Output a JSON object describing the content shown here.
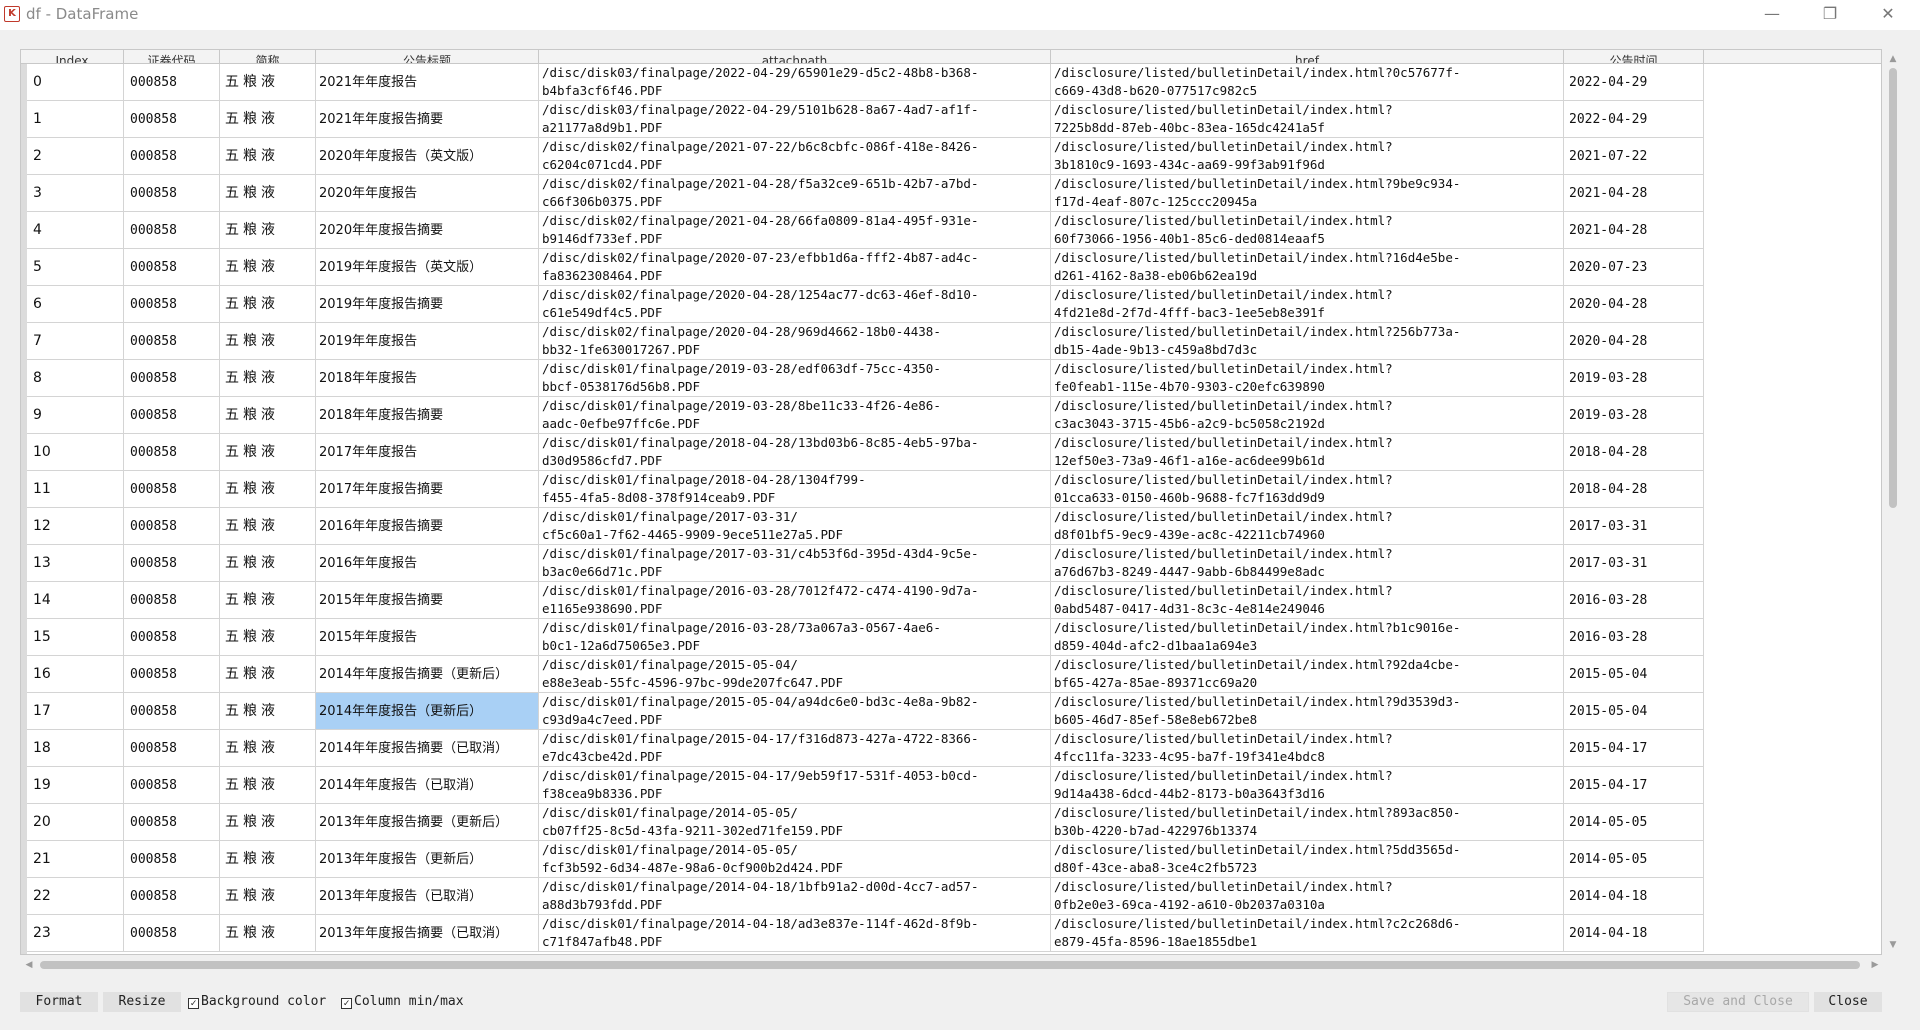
{
  "window": {
    "title": "df - DataFrame",
    "icon_glyph": "K",
    "minimize_glyph": "—",
    "restore_glyph": "❐",
    "close_glyph": "✕"
  },
  "columns": [
    "Index",
    "证券代码",
    "简称",
    "公告标题",
    "attachpath",
    "href",
    "公告时间"
  ],
  "rows": [
    {
      "index": "0",
      "code": "000858",
      "name": "五粮液",
      "title": "2021年年度报告",
      "attach": "/disc/disk03/finalpage/2022-04-29/65901e29-d5c2-48b8-b368-\nb4bfa3cf6f46.PDF",
      "href": "/disclosure/listed/bulletinDetail/index.html?0c57677f-\nc669-43d8-b620-077517c982c5",
      "date": "2022-04-29"
    },
    {
      "index": "1",
      "code": "000858",
      "name": "五粮液",
      "title": "2021年年度报告摘要",
      "attach": "/disc/disk03/finalpage/2022-04-29/5101b628-8a67-4ad7-af1f-\na21177a8d9b1.PDF",
      "href": "/disclosure/listed/bulletinDetail/index.html?\n7225b8dd-87eb-40bc-83ea-165dc4241a5f",
      "date": "2022-04-29"
    },
    {
      "index": "2",
      "code": "000858",
      "name": "五粮液",
      "title": "2020年年度报告（英文版）",
      "attach": "/disc/disk02/finalpage/2021-07-22/b6c8cbfc-086f-418e-8426-\nc6204c071cd4.PDF",
      "href": "/disclosure/listed/bulletinDetail/index.html?\n3b1810c9-1693-434c-aa69-99f3ab91f96d",
      "date": "2021-07-22"
    },
    {
      "index": "3",
      "code": "000858",
      "name": "五粮液",
      "title": "2020年年度报告",
      "attach": "/disc/disk02/finalpage/2021-04-28/f5a32ce9-651b-42b7-a7bd-\nc66f306b0375.PDF",
      "href": "/disclosure/listed/bulletinDetail/index.html?9be9c934-\nf17d-4eaf-807c-125ccc20945a",
      "date": "2021-04-28"
    },
    {
      "index": "4",
      "code": "000858",
      "name": "五粮液",
      "title": "2020年年度报告摘要",
      "attach": "/disc/disk02/finalpage/2021-04-28/66fa0809-81a4-495f-931e-\nb9146df733ef.PDF",
      "href": "/disclosure/listed/bulletinDetail/index.html?\n60f73066-1956-40b1-85c6-ded0814eaaf5",
      "date": "2021-04-28"
    },
    {
      "index": "5",
      "code": "000858",
      "name": "五粮液",
      "title": "2019年年度报告（英文版）",
      "attach": "/disc/disk02/finalpage/2020-07-23/efbb1d6a-fff2-4b87-ad4c-\nfa8362308464.PDF",
      "href": "/disclosure/listed/bulletinDetail/index.html?16d4e5be-\nd261-4162-8a38-eb06b62ea19d",
      "date": "2020-07-23"
    },
    {
      "index": "6",
      "code": "000858",
      "name": "五粮液",
      "title": "2019年年度报告摘要",
      "attach": "/disc/disk02/finalpage/2020-04-28/1254ac77-dc63-46ef-8d10-\nc61e549df4c5.PDF",
      "href": "/disclosure/listed/bulletinDetail/index.html?\n4fd21e8d-2f7d-4fff-bac3-1ee5eb8e391f",
      "date": "2020-04-28"
    },
    {
      "index": "7",
      "code": "000858",
      "name": "五粮液",
      "title": "2019年年度报告",
      "attach": "/disc/disk02/finalpage/2020-04-28/969d4662-18b0-4438-\nbb32-1fe630017267.PDF",
      "href": "/disclosure/listed/bulletinDetail/index.html?256b773a-\ndb15-4ade-9b13-c459a8bd7d3c",
      "date": "2020-04-28"
    },
    {
      "index": "8",
      "code": "000858",
      "name": "五粮液",
      "title": "2018年年度报告",
      "attach": "/disc/disk01/finalpage/2019-03-28/edf063df-75cc-4350-\nbbcf-0538176d56b8.PDF",
      "href": "/disclosure/listed/bulletinDetail/index.html?\nfe0feab1-115e-4b70-9303-c20efc639890",
      "date": "2019-03-28"
    },
    {
      "index": "9",
      "code": "000858",
      "name": "五粮液",
      "title": "2018年年度报告摘要",
      "attach": "/disc/disk01/finalpage/2019-03-28/8be11c33-4f26-4e86-\naadc-0efbe97ffc6e.PDF",
      "href": "/disclosure/listed/bulletinDetail/index.html?\nc3ac3043-3715-45b6-a2c9-bc5058c2192d",
      "date": "2019-03-28"
    },
    {
      "index": "10",
      "code": "000858",
      "name": "五粮液",
      "title": "2017年年度报告",
      "attach": "/disc/disk01/finalpage/2018-04-28/13bd03b6-8c85-4eb5-97ba-\nd30d9586cfd7.PDF",
      "href": "/disclosure/listed/bulletinDetail/index.html?\n12ef50e3-73a9-46f1-a16e-ac6dee99b61d",
      "date": "2018-04-28"
    },
    {
      "index": "11",
      "code": "000858",
      "name": "五粮液",
      "title": "2017年年度报告摘要",
      "attach": "/disc/disk01/finalpage/2018-04-28/1304f799-\nf455-4fa5-8d08-378f914ceab9.PDF",
      "href": "/disclosure/listed/bulletinDetail/index.html?\n01cca633-0150-460b-9688-fc7f163dd9d9",
      "date": "2018-04-28"
    },
    {
      "index": "12",
      "code": "000858",
      "name": "五粮液",
      "title": "2016年年度报告摘要",
      "attach": "/disc/disk01/finalpage/2017-03-31/\ncf5c60a1-7f62-4465-9909-9ece511e27a5.PDF",
      "href": "/disclosure/listed/bulletinDetail/index.html?\nd8f01bf5-9ec9-439e-ac8c-42211cb74960",
      "date": "2017-03-31"
    },
    {
      "index": "13",
      "code": "000858",
      "name": "五粮液",
      "title": "2016年年度报告",
      "attach": "/disc/disk01/finalpage/2017-03-31/c4b53f6d-395d-43d4-9c5e-\nb3ac0e66d71c.PDF",
      "href": "/disclosure/listed/bulletinDetail/index.html?\na76d67b3-8249-4447-9abb-6b84499e8adc",
      "date": "2017-03-31"
    },
    {
      "index": "14",
      "code": "000858",
      "name": "五粮液",
      "title": "2015年年度报告摘要",
      "attach": "/disc/disk01/finalpage/2016-03-28/7012f472-c474-4190-9d7a-\ne1165e938690.PDF",
      "href": "/disclosure/listed/bulletinDetail/index.html?\n0abd5487-0417-4d31-8c3c-4e814e249046",
      "date": "2016-03-28"
    },
    {
      "index": "15",
      "code": "000858",
      "name": "五粮液",
      "title": "2015年年度报告",
      "attach": "/disc/disk01/finalpage/2016-03-28/73a067a3-0567-4ae6-\nb0c1-12a6d75065e3.PDF",
      "href": "/disclosure/listed/bulletinDetail/index.html?b1c9016e-\nd859-404d-afc2-d1baa1a694e3",
      "date": "2016-03-28"
    },
    {
      "index": "16",
      "code": "000858",
      "name": "五粮液",
      "title": "2014年年度报告摘要（更新后）",
      "attach": "/disc/disk01/finalpage/2015-05-04/\ne88e3eab-55fc-4596-97bc-99de207fc647.PDF",
      "href": "/disclosure/listed/bulletinDetail/index.html?92da4cbe-\nbf65-427a-85ae-89371cc69a20",
      "date": "2015-05-04"
    },
    {
      "index": "17",
      "code": "000858",
      "name": "五粮液",
      "title": "2014年年度报告（更新后）",
      "attach": "/disc/disk01/finalpage/2015-05-04/a94dc6e0-bd3c-4e8a-9b82-\nc93d9a4c7eed.PDF",
      "href": "/disclosure/listed/bulletinDetail/index.html?9d3539d3-\nb605-46d7-85ef-58e8eb672be8",
      "date": "2015-05-04",
      "selected": true
    },
    {
      "index": "18",
      "code": "000858",
      "name": "五粮液",
      "title": "2014年年度报告摘要（已取消）",
      "attach": "/disc/disk01/finalpage/2015-04-17/f316d873-427a-4722-8366-\ne7dc43cbe42d.PDF",
      "href": "/disclosure/listed/bulletinDetail/index.html?\n4fcc11fa-3233-4c95-ba7f-19f341e4bdc8",
      "date": "2015-04-17"
    },
    {
      "index": "19",
      "code": "000858",
      "name": "五粮液",
      "title": "2014年年度报告（已取消）",
      "attach": "/disc/disk01/finalpage/2015-04-17/9eb59f17-531f-4053-b0cd-\nf38cea9b8336.PDF",
      "href": "/disclosure/listed/bulletinDetail/index.html?\n9d14a438-6dcd-44b2-8173-b0a3643f3d16",
      "date": "2015-04-17"
    },
    {
      "index": "20",
      "code": "000858",
      "name": "五粮液",
      "title": "2013年年度报告摘要（更新后）",
      "attach": "/disc/disk01/finalpage/2014-05-05/\ncb07ff25-8c5d-43fa-9211-302ed71fe159.PDF",
      "href": "/disclosure/listed/bulletinDetail/index.html?893ac850-\nb30b-4220-b7ad-422976b13374",
      "date": "2014-05-05"
    },
    {
      "index": "21",
      "code": "000858",
      "name": "五粮液",
      "title": "2013年年度报告（更新后）",
      "attach": "/disc/disk01/finalpage/2014-05-05/\nfcf3b592-6d34-487e-98a6-0cf900b2d424.PDF",
      "href": "/disclosure/listed/bulletinDetail/index.html?5dd3565d-\nd80f-43ce-aba8-3ce4c2fb5723",
      "date": "2014-05-05"
    },
    {
      "index": "22",
      "code": "000858",
      "name": "五粮液",
      "title": "2013年年度报告（已取消）",
      "attach": "/disc/disk01/finalpage/2014-04-18/1bfb91a2-d00d-4cc7-ad57-\na88d3b793fdd.PDF",
      "href": "/disclosure/listed/bulletinDetail/index.html?\n0fb2e0e3-69ca-4192-a610-0b2037a0310a",
      "date": "2014-04-18"
    },
    {
      "index": "23",
      "code": "000858",
      "name": "五粮液",
      "title": "2013年年度报告摘要（已取消）",
      "attach": "/disc/disk01/finalpage/2014-04-18/ad3e837e-114f-462d-8f9b-\nc71f847afb48.PDF",
      "href": "/disclosure/listed/bulletinDetail/index.html?c2c268d6-\ne879-45fa-8596-18ae1855dbe1",
      "date": "2014-04-18"
    }
  ],
  "footer": {
    "format_label": "Format",
    "resize_label": "Resize",
    "background_color_label": "Background color",
    "background_color_checked": true,
    "column_minmax_label": "Column min/max",
    "column_minmax_checked": true,
    "save_close_label": "Save and Close",
    "close_label": "Close"
  },
  "colors": {
    "selection": "#a9d0f5",
    "grid": "#d4d4d4"
  }
}
